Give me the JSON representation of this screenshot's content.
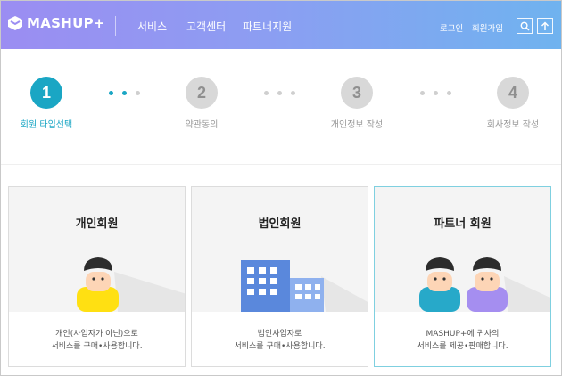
{
  "header": {
    "logo_text": "MASHUP+",
    "nav": [
      "서비스",
      "고객센터",
      "파트너지원"
    ],
    "login": "로그인",
    "join": "회원가입"
  },
  "steps": [
    {
      "number": "1",
      "label": "회원 타입선택",
      "active": true
    },
    {
      "number": "2",
      "label": "약관동의",
      "active": false
    },
    {
      "number": "3",
      "label": "개인정보 작성",
      "active": false
    },
    {
      "number": "4",
      "label": "회사정보 작성",
      "active": false
    }
  ],
  "cards": [
    {
      "title": "개인회원",
      "desc": [
        "개인(사업자가 아닌)으로",
        "서비스를 구매•사용합니다."
      ]
    },
    {
      "title": "법인회원",
      "desc": [
        "법인사업자로",
        "서비스를 구매•사용합니다."
      ]
    },
    {
      "title": "파트너 회원",
      "desc": [
        "MASHUP+에 귀사의",
        "서비스를 제공•판매합니다."
      ]
    }
  ],
  "colors": {
    "accent": "#1aa6c4",
    "header_start": "#9b8df2",
    "header_end": "#6fb3ef",
    "person_yellow": "#ffe012",
    "person_cyan": "#27a9c9",
    "person_purple": "#a58ef0",
    "building_blue": "#5a88dc"
  },
  "icons": [
    "logo-mark-icon",
    "search-icon",
    "arrow-up-icon"
  ]
}
